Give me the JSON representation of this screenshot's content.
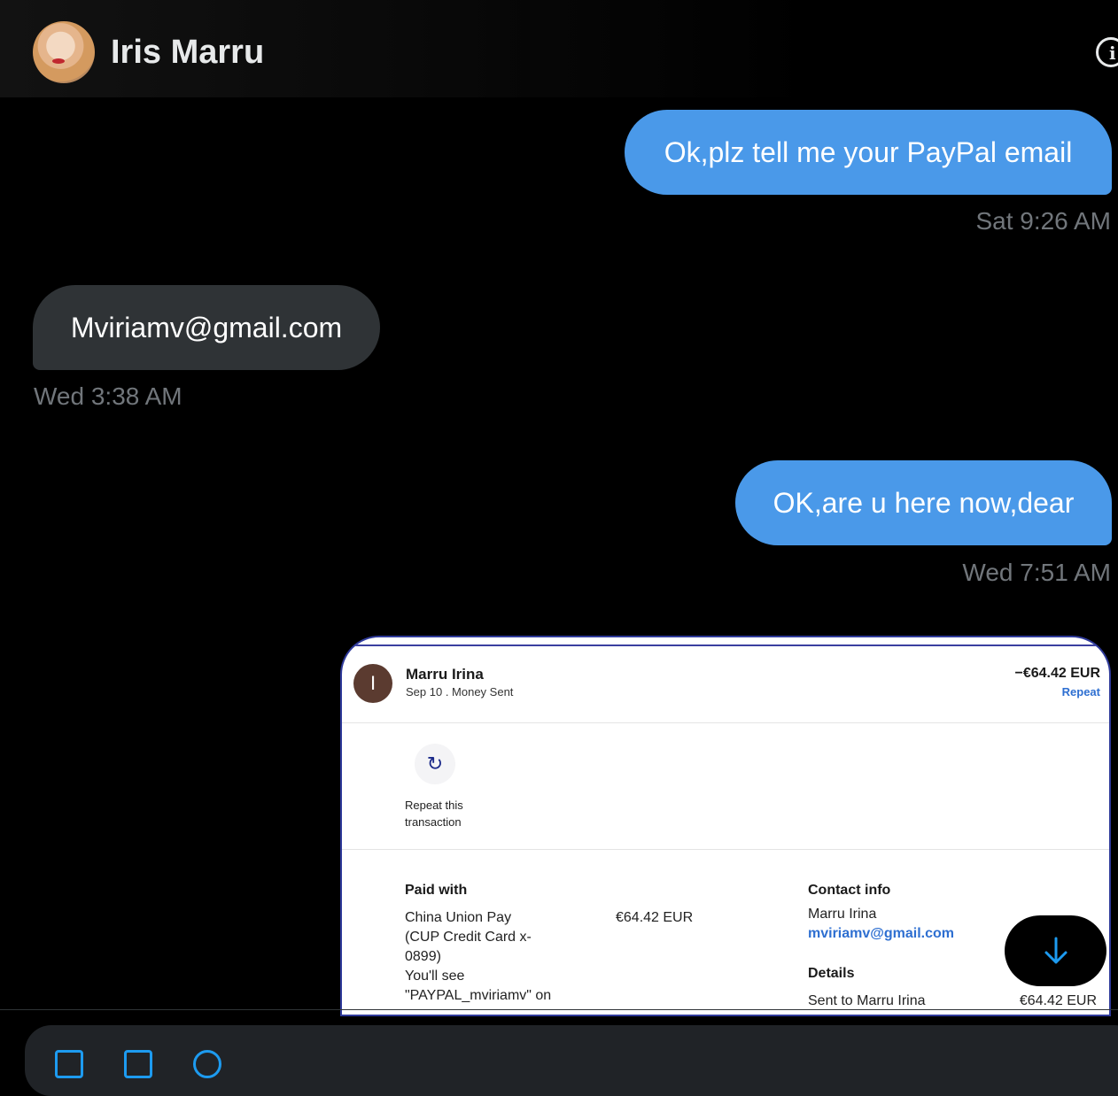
{
  "header": {
    "name": "Iris Marru",
    "avatar_icon": "avatar-photo",
    "info_icon": "info-icon",
    "info_glyph": "i"
  },
  "messages": [
    {
      "direction": "sent",
      "text": "Ok,plz tell me your PayPal email",
      "time": "Sat 9:26 AM"
    },
    {
      "direction": "received",
      "text": "Mviriamv@gmail.com",
      "time": "Wed 3:38 AM"
    },
    {
      "direction": "sent",
      "text": "OK,are u here now,dear",
      "time": "Wed 7:51 AM"
    }
  ],
  "receipt": {
    "avatar_letter": "I",
    "name": "Marru Irina",
    "subtitle": "Sep 10 . Money Sent",
    "amount": "−€64.42 EUR",
    "repeat_link": "Repeat",
    "repeat_icon": "refresh-icon",
    "repeat_glyph": "↻",
    "repeat_line1": "Repeat this",
    "repeat_line2": "transaction",
    "paid_with_heading": "Paid with",
    "paid_with_lines": [
      "China Union Pay",
      "(CUP Credit Card x-",
      "0899)",
      "You'll see",
      "\"PAYPAL_mviriamv\" on"
    ],
    "paid_amount": "€64.42 EUR",
    "contact_heading": "Contact info",
    "contact_name": "Marru Irina",
    "contact_email": "mviriamv@gmail.com",
    "details_heading": "Details",
    "details_line": "Sent to Marru Irina",
    "details_amount": "€64.42 EUR"
  },
  "scroll_down_icon": "arrow-down-icon",
  "colors": {
    "sent_bubble": "#4a99e9",
    "received_bubble": "#2f3336",
    "timestamp": "#71767b",
    "accent": "#1d9bf0"
  }
}
